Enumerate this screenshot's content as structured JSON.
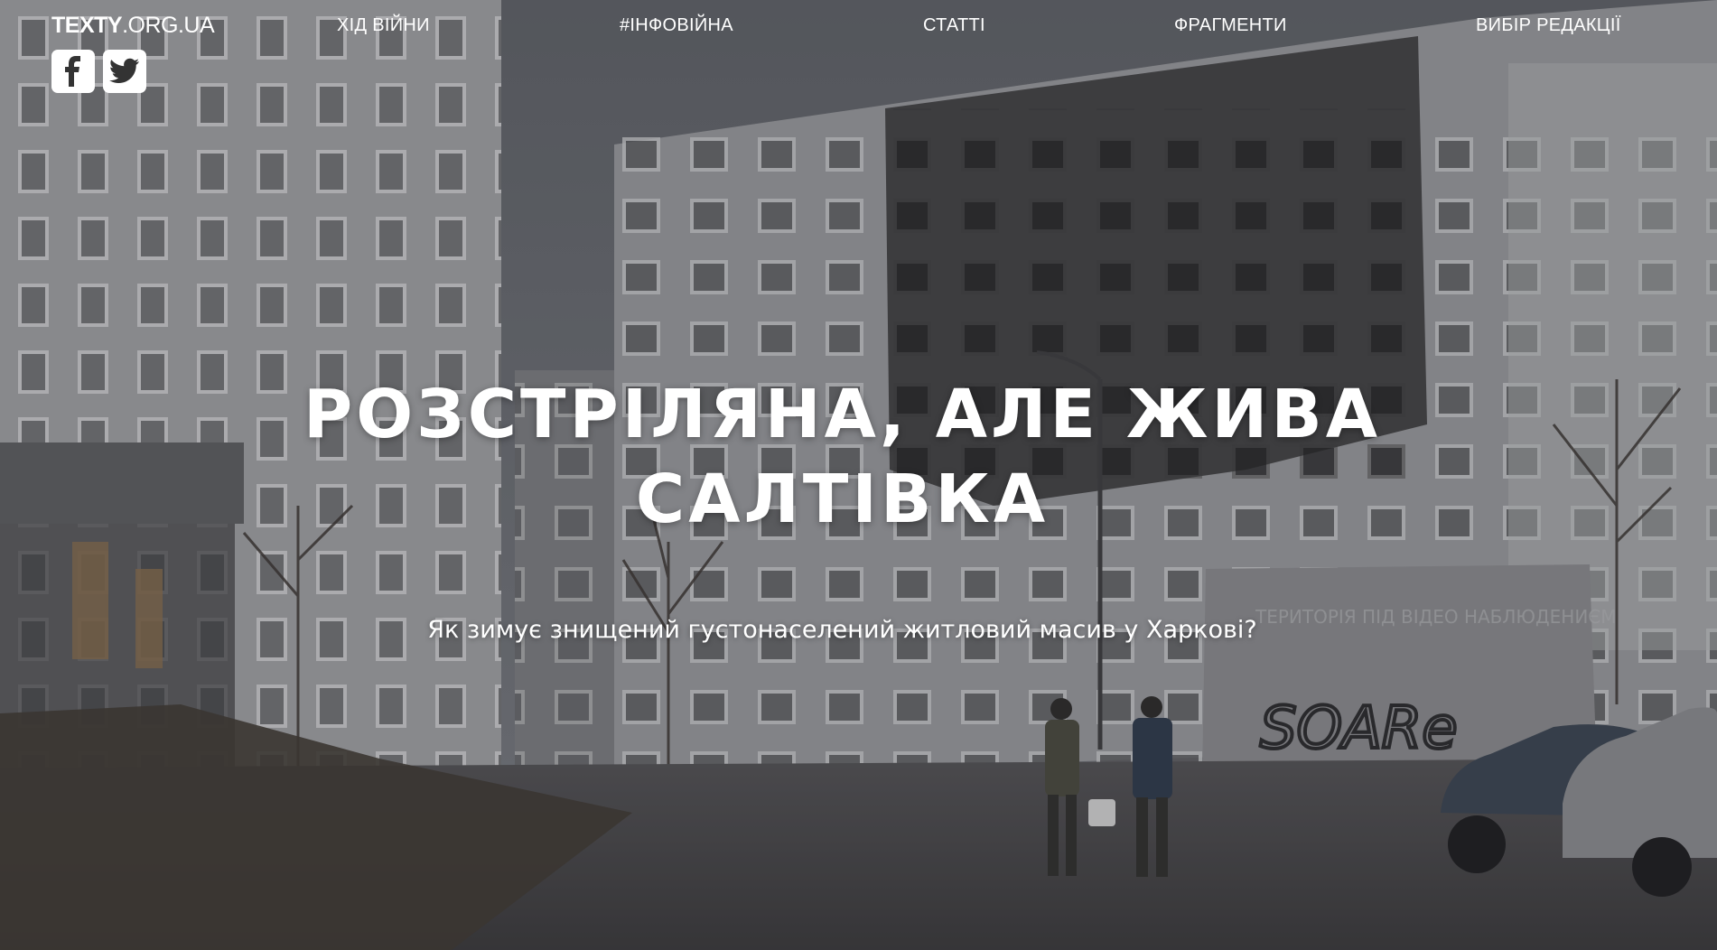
{
  "site": {
    "logo_bold": "TEXTY",
    "logo_light": ".ORG.UA"
  },
  "social": [
    {
      "icon": "facebook-icon"
    },
    {
      "icon": "twitter-icon"
    }
  ],
  "nav": [
    {
      "label": "ХІД ВІЙНИ"
    },
    {
      "label": "#ІНФОВІЙНА"
    },
    {
      "label": "СТАТТІ"
    },
    {
      "label": "ФРАГМЕНТИ"
    },
    {
      "label": "ВИБІР РЕДАКЦІЇ"
    }
  ],
  "hero": {
    "title_line1": "РОЗСТРІЛЯНА, АЛЕ ЖИВА",
    "title_line2": "САЛТІВКА",
    "subtitle": "Як зимує знищений густонаселений житловий масив у Харкові?",
    "graffiti_text": "SOARe",
    "wall_sign": "ТЕРИТОРІЯ ПІД ВІДЕО НАБЛЮДЕНИЄМ"
  },
  "colors": {
    "sky": "#6b6e74",
    "building": "#a7a8ab",
    "burn": "#2b2b2d",
    "ground": "#4e4d4f",
    "text": "#ffffff"
  }
}
